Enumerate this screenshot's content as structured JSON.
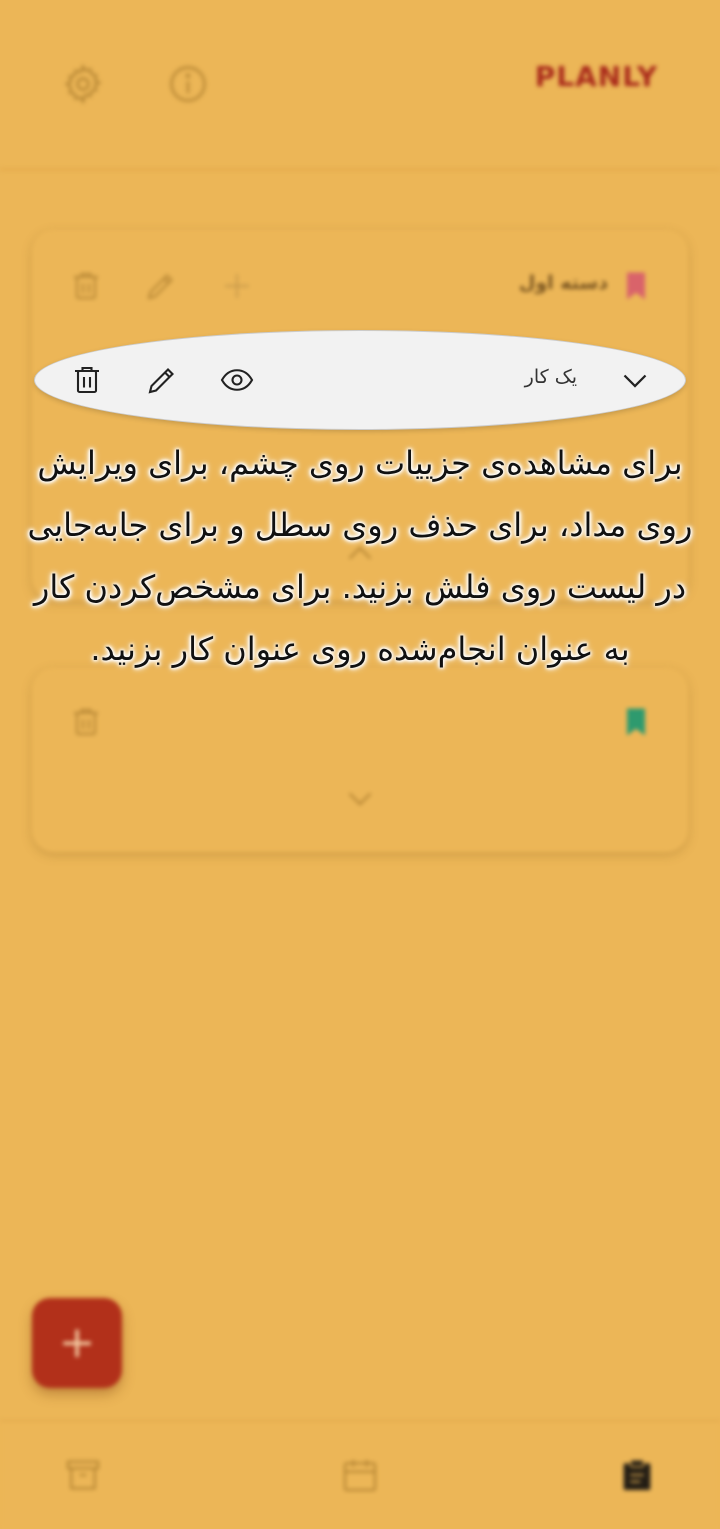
{
  "app": {
    "title": "PLANLY"
  },
  "header": {
    "settings_icon": "gear-icon",
    "info_icon": "info-icon"
  },
  "categories": [
    {
      "title": "دسته اول",
      "bookmark_color": "#d9636a"
    },
    {
      "title": "",
      "bookmark_color": "#2e9a6e"
    }
  ],
  "task": {
    "title": "یک کار"
  },
  "hint": {
    "text": "برای مشاهده‌ی جزییات روی چشم، برای ویرایش روی مداد، برای حذف روی سطل و برای جابه‌جایی در لیست روی فلش بزنید. برای مشخص‌کردن کار به عنوان انجام‌شده روی عنوان کار بزنید."
  },
  "fab": {
    "label": "+"
  },
  "colors": {
    "background": "#ECB657",
    "accent": "#B2301A",
    "logo": "#A92A1B"
  },
  "bottom_nav": [
    "archive-icon",
    "calendar-icon",
    "clipboard-icon"
  ]
}
